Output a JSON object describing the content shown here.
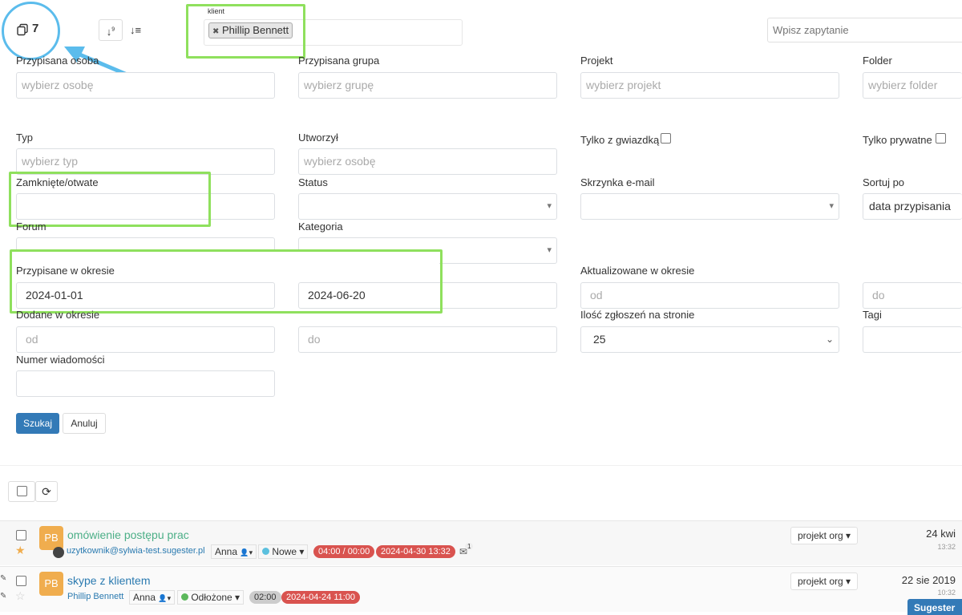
{
  "topbar": {
    "count": "7",
    "client_label": "klient",
    "client_tag": "Phillip Bennett",
    "search_placeholder": "Wpisz zapytanie"
  },
  "filters": {
    "assigned_person": {
      "label": "Przypisana osoba",
      "placeholder": "wybierz osobę"
    },
    "assigned_group": {
      "label": "Przypisana grupa",
      "placeholder": "wybierz grupę"
    },
    "project": {
      "label": "Projekt",
      "placeholder": "wybierz projekt"
    },
    "folder": {
      "label": "Folder",
      "placeholder": "wybierz folder"
    },
    "type": {
      "label": "Typ",
      "placeholder": "wybierz typ"
    },
    "created_by": {
      "label": "Utworzył",
      "placeholder": "wybierz osobę"
    },
    "starred_only": {
      "label": "Tylko z gwiazdką"
    },
    "private_only": {
      "label": "Tylko prywatne"
    },
    "closed_open": {
      "label": "Zamknięte/otwate",
      "value": ""
    },
    "status": {
      "label": "Status",
      "value": ""
    },
    "mailbox": {
      "label": "Skrzynka e-mail",
      "value": ""
    },
    "sort_by": {
      "label": "Sortuj po",
      "value": "data przypisania"
    },
    "forum": {
      "label": "Forum",
      "value": ""
    },
    "category": {
      "label": "Kategoria",
      "value": ""
    },
    "assigned_period": {
      "label": "Przypisane w okresie",
      "from": "2024-01-01",
      "to": "2024-06-20"
    },
    "updated_period": {
      "label": "Aktualizowane w okresie",
      "from_placeholder": "od",
      "to_placeholder": "do"
    },
    "added_period": {
      "label": "Dodane w okresie",
      "from_placeholder": "od",
      "to_placeholder": "do"
    },
    "per_page": {
      "label": "Ilość zgłoszeń na stronie",
      "value": "25"
    },
    "tags": {
      "label": "Tagi"
    },
    "message_number": {
      "label": "Numer wiadomości",
      "value": ""
    }
  },
  "actions": {
    "search": "Szukaj",
    "cancel": "Anuluj"
  },
  "tickets": [
    {
      "initials": "PB",
      "title": "omówienie postępu prac",
      "requester": "uzytkownik@sylwia-test.sugester.pl",
      "assignee": "Anna",
      "status": "Nowe",
      "status_color": "#5bc0de",
      "time": "04:00 / 00:00",
      "deadline": "2024-04-30 13:32",
      "mail_count": "1",
      "project": "projekt org",
      "date": "24 kwi",
      "hour": "13:32"
    },
    {
      "initials": "PB",
      "title": "skype z klientem",
      "requester": "Phillip Bennett",
      "assignee": "Anna",
      "status": "Odłożone",
      "status_color": "#5cb85c",
      "time": "02:00",
      "deadline": "2024-04-24 11:00",
      "project": "projekt org",
      "date": "22 sie 2019",
      "hour": "10:32"
    }
  ],
  "widget": {
    "label": "Sugester"
  },
  "colors": {
    "highlight": "#8fe05d",
    "arrow": "#5bbcec",
    "primary": "#337ab7",
    "danger": "#d9534f"
  }
}
